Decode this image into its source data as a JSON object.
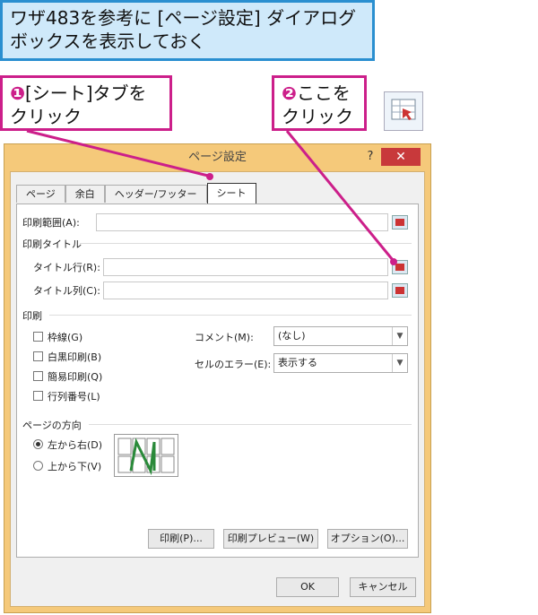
{
  "callouts": {
    "top": "ワザ483を参考に [ページ設定] ダイアログ\nボックスを表示しておく",
    "step1_num": "❶",
    "step1": "[シート]タブを\nクリック",
    "step2_num": "❷",
    "step2": "ここを\nクリック"
  },
  "dialog": {
    "title": "ページ設定",
    "help": "?",
    "close": "✕",
    "tabs": [
      "ページ",
      "余白",
      "ヘッダー/フッター",
      "シート"
    ],
    "print_area_label": "印刷範囲(A):",
    "print_titles_label": "印刷タイトル",
    "title_rows_label": "タイトル行(R):",
    "title_cols_label": "タイトル列(C):",
    "print_label": "印刷",
    "gridlines": "枠線(G)",
    "bw": "白黒印刷(B)",
    "draft": "簡易印刷(Q)",
    "headings": "行列番号(L)",
    "comments_label": "コメント(M):",
    "comments_value": "(なし)",
    "errors_label": "セルのエラー(E):",
    "errors_value": "表示する",
    "order_label": "ページの方向",
    "order_option1": "左から右(D)",
    "order_option2": "上から下(V)",
    "print_btn": "印刷(P)...",
    "preview_btn": "印刷プレビュー(W)",
    "options_btn": "オプション(O)...",
    "ok_btn": "OK",
    "cancel_btn": "キャンセル"
  },
  "colors": {
    "accent": "#cc1f8a",
    "blue": "#2a8fd0",
    "frame": "#f5c97a",
    "close": "#c8393b"
  }
}
